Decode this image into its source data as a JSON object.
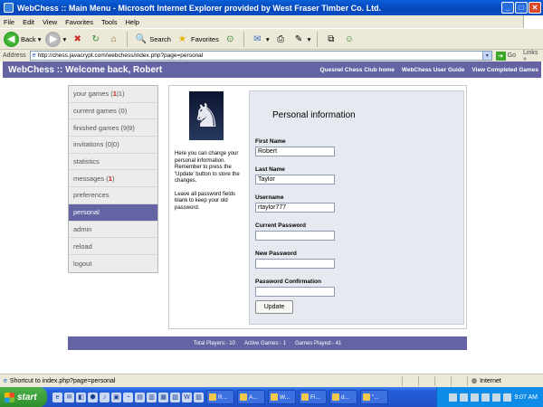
{
  "window": {
    "title": "WebChess :: Main Menu - Microsoft Internet Explorer provided by West Fraser Timber Co. Ltd.",
    "min": "_",
    "max": "□",
    "close": "✕"
  },
  "menu": [
    "File",
    "Edit",
    "View",
    "Favorites",
    "Tools",
    "Help"
  ],
  "toolbar": {
    "back": "Back",
    "back_glyph": "◀",
    "forward_glyph": "▶",
    "stop_glyph": "✖",
    "refresh_glyph": "↻",
    "home_glyph": "⌂",
    "search": "Search",
    "search_glyph": "🔍",
    "favorites": "Favorites",
    "favorites_glyph": "★",
    "media_glyph": "⊙",
    "mail_glyph": "✉",
    "print_glyph": "⎙",
    "edit_glyph": "✎",
    "discuss_glyph": "⧉",
    "messenger_glyph": "☺",
    "drop": "▾"
  },
  "address": {
    "label": "Address",
    "url": "http://chess.javacrypt.com/webchess/index.php?page=personal",
    "ie_glyph": "e",
    "go": "Go",
    "go_glyph": "➔",
    "links": "Links",
    "links_glyph": "»"
  },
  "header": {
    "title": "WebChess :: Welcome back, Robert",
    "links": [
      "Quesnel Chess Club home",
      "WebChess User Guide",
      "View Completed Games"
    ]
  },
  "sidebar": {
    "items": [
      {
        "label": "your games (",
        "n1": "1",
        "sep": "|",
        "n2": "1",
        "close": ")"
      },
      {
        "label": "current games (0)"
      },
      {
        "label": "finished games (9|9)"
      },
      {
        "label": "invitations (0|0)"
      },
      {
        "label": "statistics"
      },
      {
        "label": "messages (",
        "n1": "1",
        "close": ")"
      },
      {
        "label": "preferences"
      },
      {
        "label": "personal"
      },
      {
        "label": "admin"
      },
      {
        "label": "reload"
      },
      {
        "label": "logout"
      }
    ]
  },
  "panel": {
    "knight_glyph": "♞",
    "help1": "Here you can change your personal information. Remember to press the 'Update' button to store the changes.",
    "help2": "Leave all password fields blank to keep your old password.",
    "form_title": "Personal information",
    "fields": [
      {
        "label": "First Name",
        "value": "Robert"
      },
      {
        "label": "Last Name",
        "value": "Taylor"
      },
      {
        "label": "Username",
        "value": "rtaylor777"
      },
      {
        "label": "Current Password",
        "value": ""
      },
      {
        "label": "New Password",
        "value": ""
      },
      {
        "label": "Password Confirmation",
        "value": ""
      }
    ],
    "update": "Update"
  },
  "footer": {
    "total": "Total Players:- 10",
    "active": "Active Games:- 1",
    "played": "Games Played:- 41"
  },
  "status": {
    "icon": "e",
    "text": "Shortcut to index.php?page=personal",
    "zone": "Internet",
    "zone_glyph": "◍"
  },
  "taskbar": {
    "start": "start",
    "quick": [
      "e",
      "✉",
      "◧",
      "⬢",
      "♪",
      "▣",
      "◔",
      "▤",
      "▥",
      "▦",
      "▧",
      "W",
      "▨"
    ],
    "tasks": [
      "R...",
      "A...",
      "W...",
      "Fi...",
      "d...",
      "\"..."
    ],
    "time": "9:07 AM"
  }
}
